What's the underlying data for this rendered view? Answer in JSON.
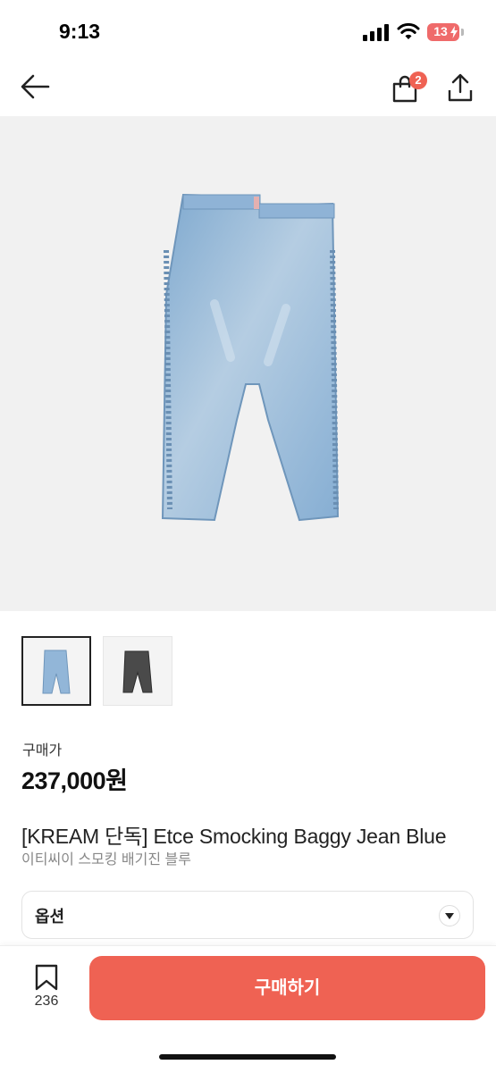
{
  "status": {
    "time": "9:13",
    "battery": "13"
  },
  "nav": {
    "cart_count": "2"
  },
  "colors": {
    "accent": "#ef6253",
    "badge": "#ef6253"
  },
  "icons": [
    "back-arrow-icon",
    "shopping-bag-icon",
    "share-icon",
    "bookmark-icon",
    "chevron-down-icon"
  ],
  "product": {
    "price_label": "구매가",
    "price": "237,000원",
    "title": "[KREAM 단독] Etce Smocking Baggy Jean Blue",
    "subtitle": "이티씨이 스모킹 배기진 블루"
  },
  "option": {
    "label": "옵션"
  },
  "bottom": {
    "bookmark_count": "236",
    "buy_label": "구매하기"
  }
}
